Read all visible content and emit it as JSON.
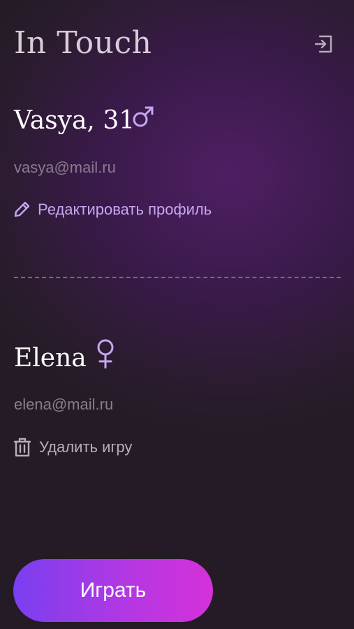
{
  "app": {
    "title": "In Touch"
  },
  "user": {
    "name": "Vasya, 31",
    "email": "vasya@mail.ru",
    "edit_label": "Редактировать профиль"
  },
  "partner": {
    "name": "Elena",
    "email": "elena@mail.ru",
    "delete_label": "Удалить игру"
  },
  "play_label": "Играть",
  "icons": {
    "logout": "logout-icon",
    "male": "male-icon",
    "female": "female-icon",
    "pencil": "pencil-icon",
    "trash": "trash-icon"
  },
  "colors": {
    "accent": "#c5a6f2",
    "gradient_start": "#7a3ff0",
    "gradient_end": "#d531d9"
  }
}
